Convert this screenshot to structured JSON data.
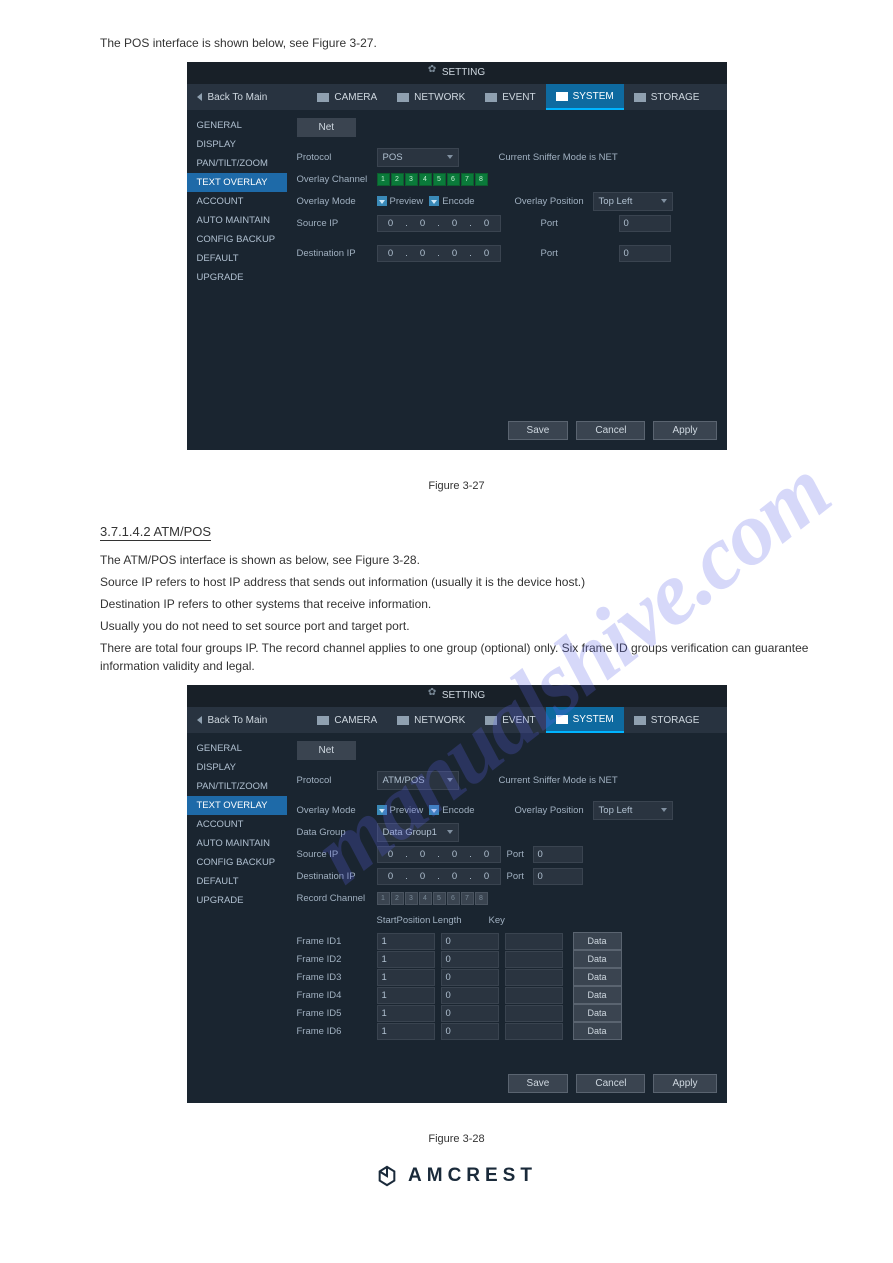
{
  "watermark": "manualshive.com",
  "doc": {
    "intro_line": "The POS interface is shown below, see Figure 3-27.",
    "fig27_caption": "Figure 3-27",
    "atm_title": "3.7.1.4.2 ATM/POS",
    "atm_p1": "The ATM/POS interface is shown as below, see Figure 3-28.",
    "atm_p2": "Source IP refers to host IP address that sends out information (usually it is the device host.)",
    "atm_p3": "Destination IP refers to other systems that receive information.",
    "atm_p4": "Usually you do not need to set source port and target port.",
    "atm_p5": "There are total four groups IP. The record channel applies to one group (optional) only. Six frame ID groups verification can guarantee information validity and legal.",
    "fig28_caption": "Figure 3-28"
  },
  "app": {
    "title": "SETTING",
    "back": "Back To Main",
    "tabs": {
      "camera": "CAMERA",
      "network": "NETWORK",
      "event": "EVENT",
      "system": "SYSTEM",
      "storage": "STORAGE"
    },
    "sidebar": [
      "GENERAL",
      "DISPLAY",
      "PAN/TILT/ZOOM",
      "TEXT OVERLAY",
      "ACCOUNT",
      "AUTO MAINTAIN",
      "CONFIG BACKUP",
      "DEFAULT",
      "UPGRADE"
    ],
    "subtab": "Net",
    "labels": {
      "protocol": "Protocol",
      "overlay_channel": "Overlay Channel",
      "overlay_mode": "Overlay Mode",
      "source_ip": "Source IP",
      "destination_ip": "Destination IP",
      "sniffer": "Current Sniffer Mode is NET",
      "overlay_position": "Overlay Position",
      "port": "Port",
      "preview": "Preview",
      "encode": "Encode",
      "data_group": "Data Group",
      "record_channel": "Record Channel",
      "start_position": "StartPosition",
      "length": "Length",
      "key": "Key",
      "data_btn": "Data"
    },
    "values": {
      "protocol_pos": "POS",
      "protocol_atm": "ATM/POS",
      "position": "Top Left",
      "data_group": "Data Group1",
      "ip_zero": "0",
      "port_zero": "0",
      "sp_one": "1",
      "len_zero": "0"
    },
    "channels": [
      "1",
      "2",
      "3",
      "4",
      "5",
      "6",
      "7",
      "8"
    ],
    "frame_ids": [
      "Frame ID1",
      "Frame ID2",
      "Frame ID3",
      "Frame ID4",
      "Frame ID5",
      "Frame ID6"
    ],
    "buttons": {
      "save": "Save",
      "cancel": "Cancel",
      "apply": "Apply"
    }
  },
  "logo": "AMCREST"
}
